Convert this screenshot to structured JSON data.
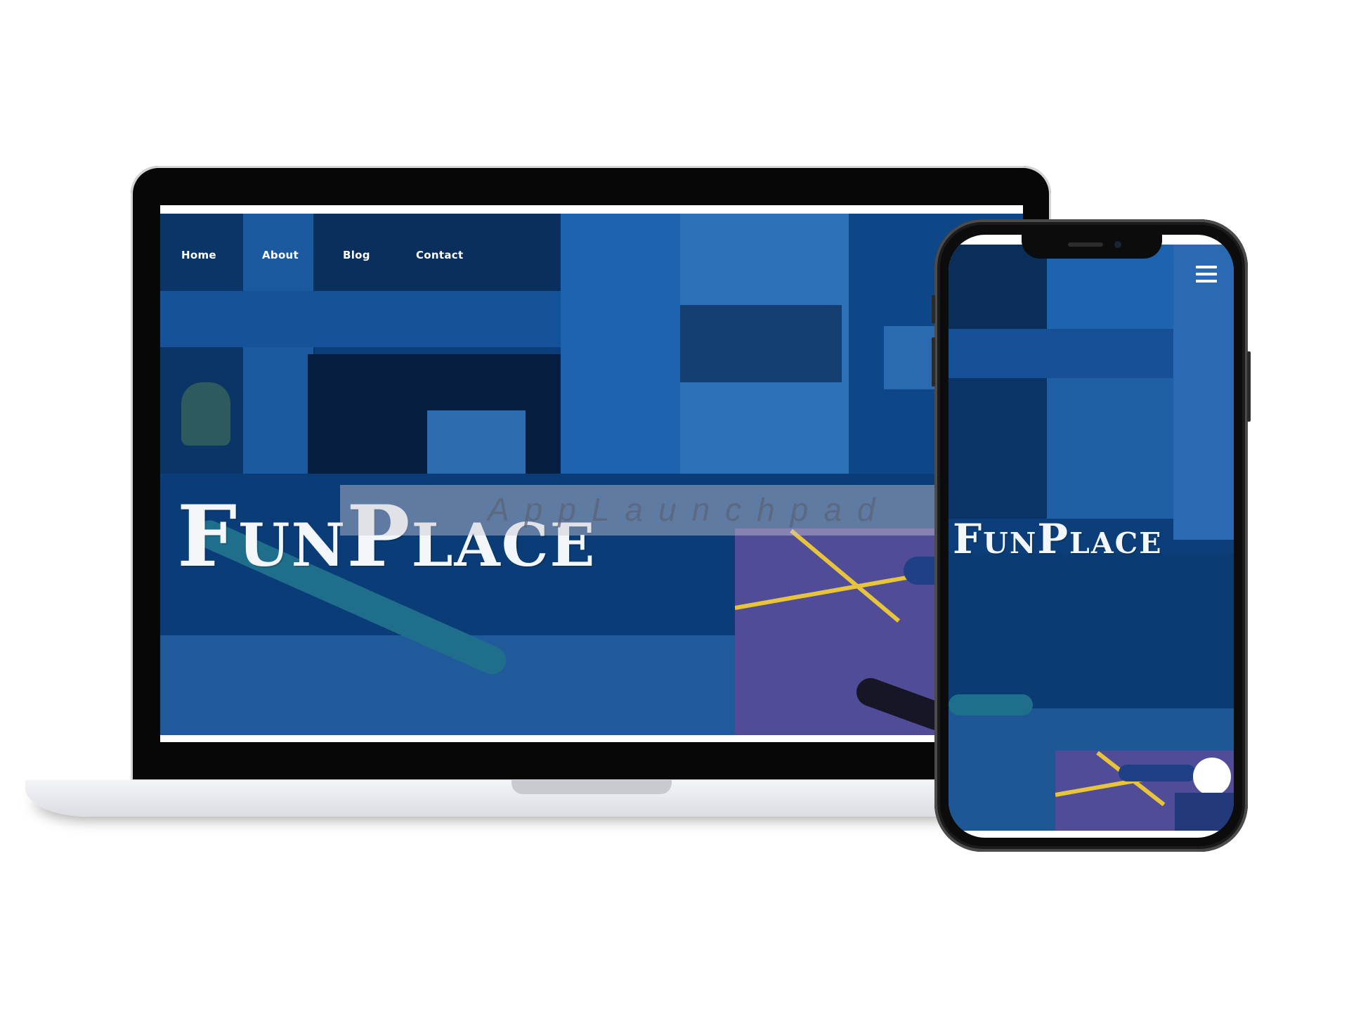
{
  "desktop": {
    "nav": {
      "home": "Home",
      "about": "About",
      "blog": "Blog",
      "contact": "Contact"
    },
    "logo": "FunPlace"
  },
  "mobile": {
    "logo": "FunPlace",
    "menu_icon": "hamburger-menu-icon"
  },
  "watermark": "AppLaunchpad",
  "colors": {
    "hero_overlay": "#0d3f78",
    "accent_lines": "#e8c43b",
    "logo_text": "#f4f7f9"
  }
}
